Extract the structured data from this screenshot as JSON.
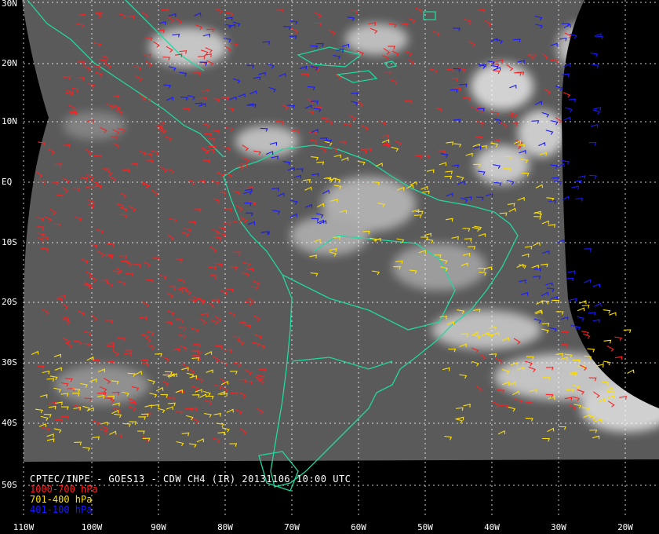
{
  "map": {
    "title": "CPTEC/INPE - GOES13 - CDW CH4 (IR) 20131106 10:00 UTC",
    "latitude_labels": [
      "30N",
      "20N",
      "10N",
      "EQ",
      "10S",
      "20S",
      "30S",
      "40S",
      "50S"
    ],
    "longitude_labels": [
      "110W",
      "100W",
      "90W",
      "80W",
      "70W",
      "60W",
      "50W",
      "40W",
      "30W",
      "20W"
    ],
    "legend": [
      {
        "label": "1000-700 hPa",
        "color": "#ff2020"
      },
      {
        "label": "701-400 hPa",
        "color": "#ffe000"
      },
      {
        "label": "401-100 hPa",
        "color": "#1a1aff"
      }
    ],
    "colors": {
      "background": "#000000",
      "coastline": "#20d8a0",
      "graticule": "#ffffff",
      "satellite_gray": "#5a5a5a"
    }
  }
}
